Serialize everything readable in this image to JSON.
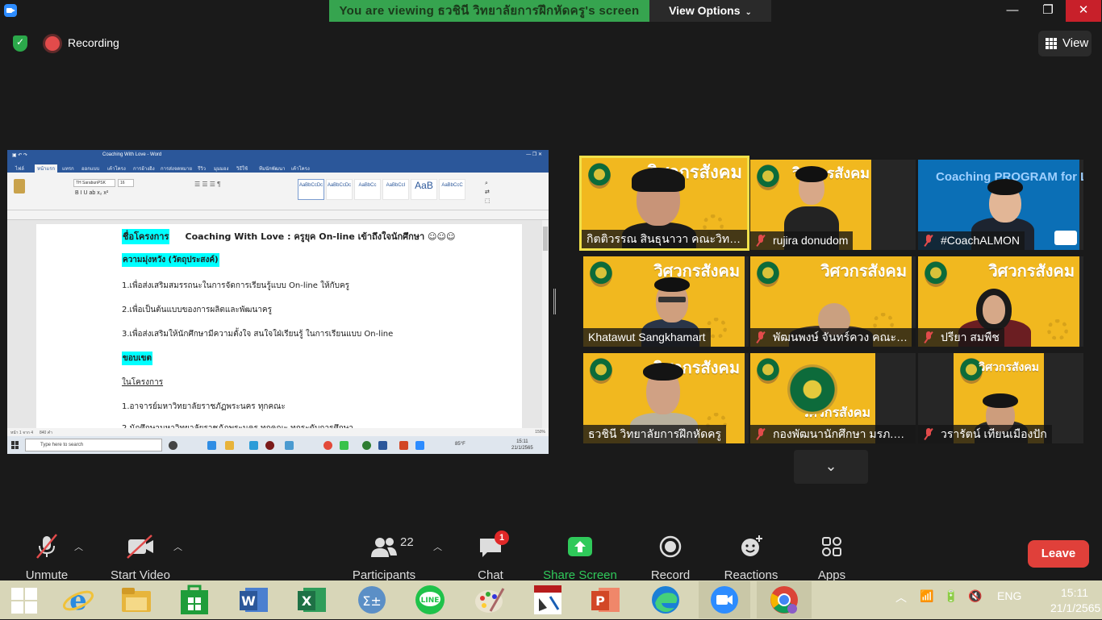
{
  "top_bar": {
    "viewing_text": "You are viewing ธวชินี วิทยาลัยการฝึกหัดครู's screen",
    "view_options_label": "View Options",
    "minimize": "—",
    "maximize": "❐",
    "close": "✕"
  },
  "info_row": {
    "recording_label": "Recording",
    "view_label": "View"
  },
  "shared_doc": {
    "window_title": "Coaching With Love - Word",
    "tabs": [
      "ไฟล์",
      "หน้าแรก",
      "แทรก",
      "ออกแบบ",
      "เค้าโครง",
      "การอ้างอิง",
      "การส่งจดหมาย",
      "รีวิว",
      "มุมมอง",
      "วิธีใช้",
      "ทีมนักพัฒนา",
      "เค้าโครง"
    ],
    "font_name": "TH SarabunPSK",
    "font_size": "16",
    "styles": [
      "AaBbCcDc",
      "AaBbCcDc",
      "AaBbCc",
      "AaBbCcI",
      "AaB",
      "AaBbCcC"
    ],
    "line1_label": "ชื่อโครงการ",
    "line1_title": "Coaching With Love : ครูยุค On-line เข้าถึงใจนักศึกษา ☺☺☺",
    "line2_label": "ความมุ่งหวัง (วัตถุประสงค์)",
    "line3": "1.เพื่อส่งเสริมสมรรถนะในการจัดการเรียนรู้แบบ On-line ให้กับครู",
    "line4": "2.เพื่อเป็นต้นแบบของการผลิตและพัฒนาครู",
    "line5": "3.เพื่อส่งเสริมให้นักศึกษามีความตั้งใจ สนใจใฝ่เรียนรู้ ในการเรียนแบบ On-line",
    "line6_label": "ขอบเขต",
    "line7": "ในโครงการ",
    "line8": "1.อาจารย์มหาวิทยาลัยราชภัฏพระนคร ทุกคณะ",
    "line9": "2.นักศึกษามหาวิทยาลัยราชภัฏพระนคร ทุกคณะ ทุกระดับการศึกษา",
    "status_left": "หน้า 1 จาก 4",
    "status_words": "840 คำ",
    "status_zoom": "150%",
    "search_placeholder": "Type here to search",
    "inner_temp": "85°F",
    "inner_time": "15:11",
    "inner_date": "21/1/2565"
  },
  "tiles": [
    {
      "name": "กิตติวรรณ สินธุนาวา คณะวิทยาศาสตร์",
      "muted": false,
      "active": true
    },
    {
      "name": "rujira donudom",
      "muted": true,
      "active": false
    },
    {
      "name": "#CoachALMON",
      "muted": true,
      "active": false
    },
    {
      "name": "Khatawut Sangkhamart",
      "muted": false,
      "active": false
    },
    {
      "name": "พัฒนพงษ์ จันทร์ควง คณะวิทยาการ",
      "muted": true,
      "active": false
    },
    {
      "name": "ปรียา สมพืช",
      "muted": true,
      "active": false
    },
    {
      "name": "ธวชินี วิทยาลัยการฝึกหัดครู",
      "muted": false,
      "active": false
    },
    {
      "name": "กองพัฒนานักศึกษา มรภ.พระนคร",
      "muted": true,
      "active": false
    },
    {
      "name": "วรารัตน์ เทียนเมืองปัก",
      "muted": true,
      "active": false
    }
  ],
  "tile_brand": "วิศวกรสังคม",
  "coach_banner": "Coaching PROGRAM for L",
  "toolbar": {
    "unmute": "Unmute",
    "start_video": "Start Video",
    "participants": "Participants",
    "participants_count": "22",
    "chat": "Chat",
    "chat_badge": "1",
    "share_screen": "Share Screen",
    "record": "Record",
    "reactions": "Reactions",
    "apps": "Apps",
    "leave": "Leave"
  },
  "taskbar": {
    "language": "ENG",
    "time": "15:11",
    "date": "21/1/2565"
  },
  "colors": {
    "share_green": "#36a44f",
    "leave_red": "#e0403a",
    "tile_yellow": "#f1b81f",
    "active_outline": "#f0e04a",
    "highlight_cyan": "#00ffff"
  }
}
